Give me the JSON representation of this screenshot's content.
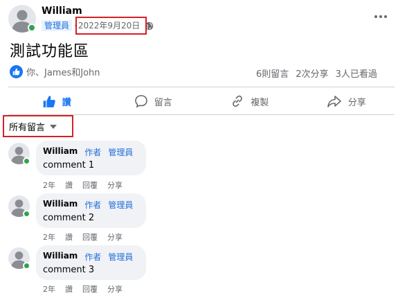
{
  "post": {
    "author": "William",
    "role_badge": "管理員",
    "date": "2022年9月20日",
    "privacy_icon": "globe-icon",
    "text": "測試功能區"
  },
  "reactions": {
    "names": "你、James和John",
    "comment_count": "6則留言",
    "share_count": "2次分享",
    "seen_count": "3人已看過"
  },
  "actions": {
    "like": "讚",
    "comment": "留言",
    "copy": "複製",
    "share": "分享"
  },
  "sort": {
    "label": "所有留言"
  },
  "comments": [
    {
      "author": "William",
      "tag_author": "作者",
      "tag_admin": "管理員",
      "text": "comment 1",
      "time": "2年",
      "like": "讚",
      "reply": "回覆",
      "share": "分享"
    },
    {
      "author": "William",
      "tag_author": "作者",
      "tag_admin": "管理員",
      "text": "comment 2",
      "time": "2年",
      "like": "讚",
      "reply": "回覆",
      "share": "分享"
    },
    {
      "author": "William",
      "tag_author": "作者",
      "tag_admin": "管理員",
      "text": "comment 3",
      "time": "2年",
      "like": "讚",
      "reply": "回覆",
      "share": "分享"
    }
  ],
  "colors": {
    "accent": "#1877f2",
    "badge_text": "#216fdb",
    "highlight": "#d61f26",
    "online": "#31a24c"
  }
}
